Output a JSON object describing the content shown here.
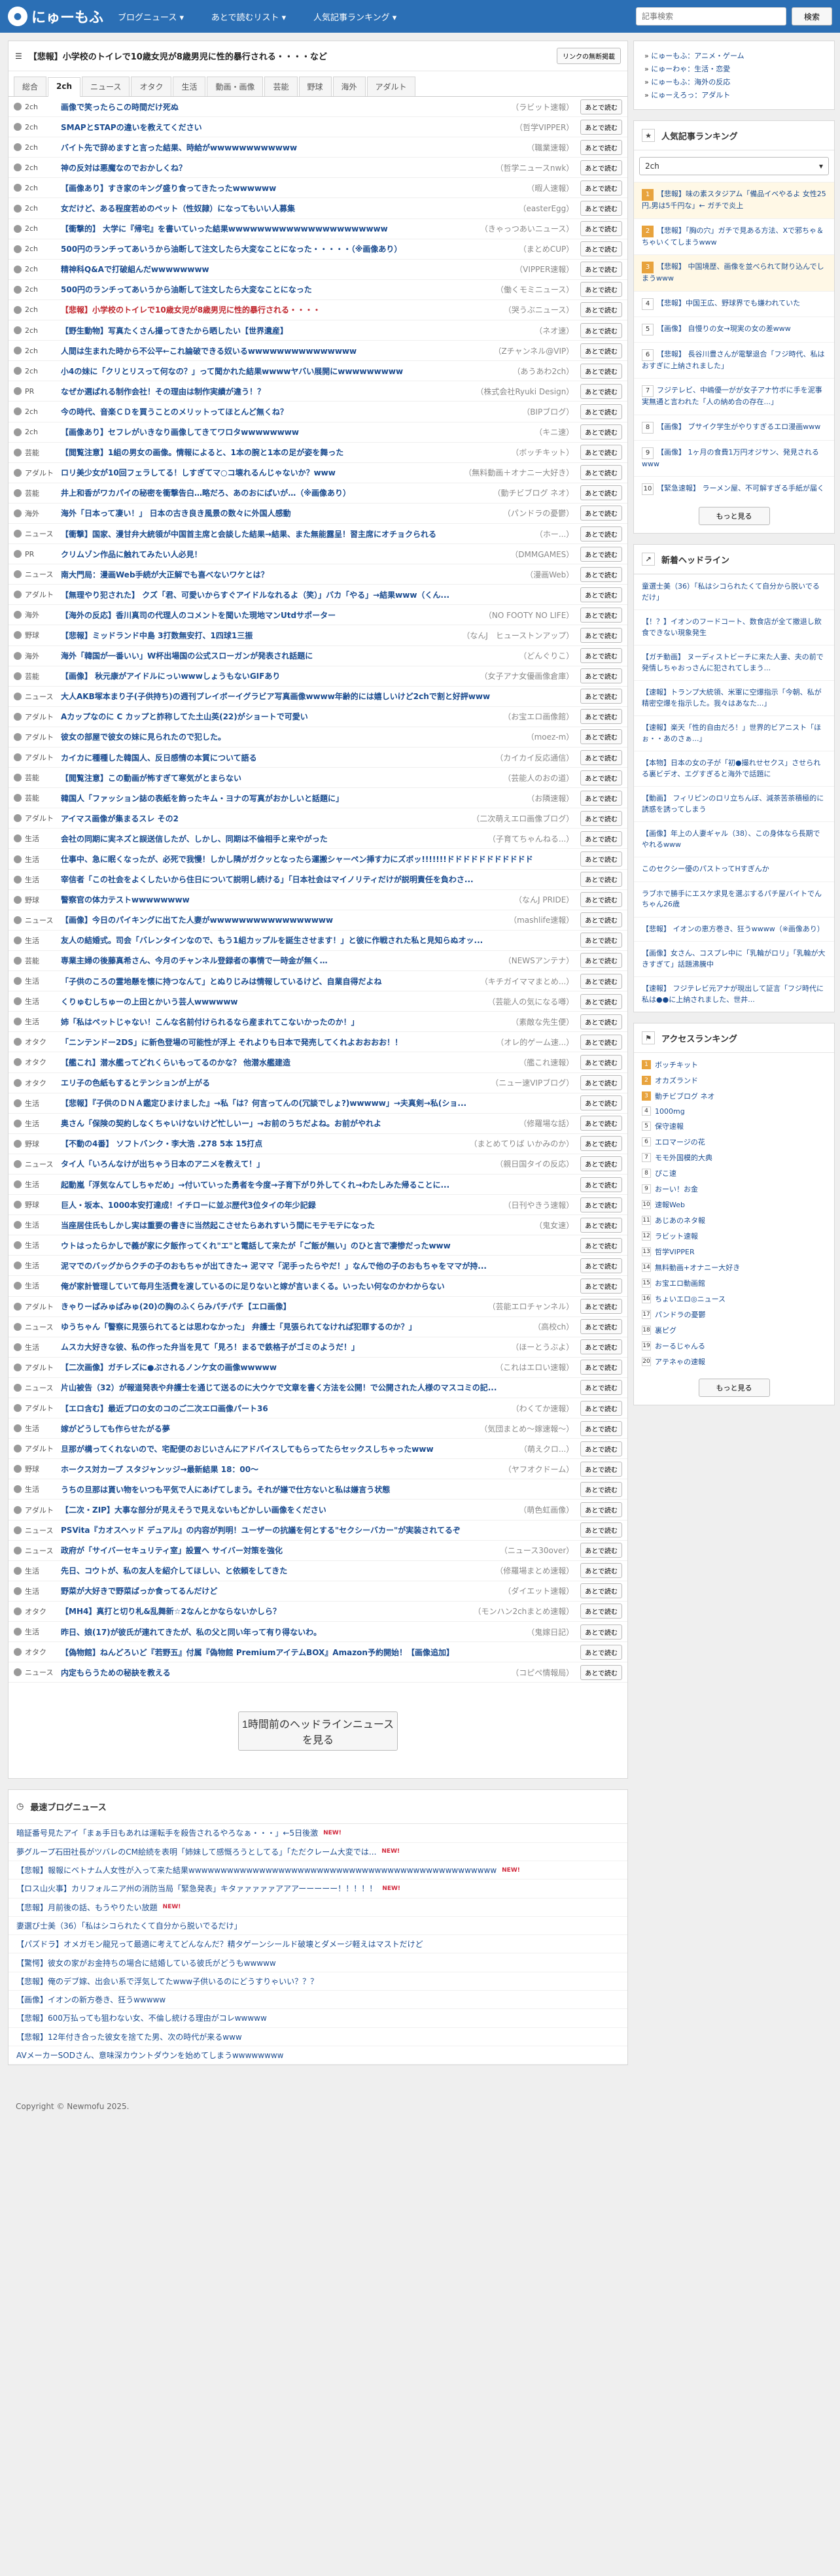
{
  "header": {
    "logo": "にゅーもふ",
    "nav": [
      "ブログニュース ▾",
      "あとで読むリスト ▾",
      "人気記事ランキング ▾"
    ],
    "search_placeholder": "記事検索",
    "search_button": "検索"
  },
  "headline": {
    "text": "【悲報】小学校のトイレで10歳女児が8歳男児に性的暴行される・・・・など",
    "button": "リンクの無断掲載"
  },
  "tabs": [
    "総合",
    "2ch",
    "ニュース",
    "オタク",
    "生活",
    "動画・画像",
    "芸能",
    "野球",
    "海外",
    "アダルト"
  ],
  "later_label": "あとで読む",
  "articles": [
    {
      "cat": "2ch",
      "title": "画像で笑ったらこの時間だけ死ぬ",
      "src": "（ラビット速報）"
    },
    {
      "cat": "2ch",
      "title": "SMAPとSTAPの違いを教えてください",
      "src": "（哲学VIPPER）"
    },
    {
      "cat": "2ch",
      "title": "バイト先で辞めますと言った結果、時給がwwwwwwwwwwww",
      "src": "（職業速報）"
    },
    {
      "cat": "2ch",
      "title": "神の反対は悪魔なのでおかしくね？",
      "src": "（哲学ニュースnwk）"
    },
    {
      "cat": "2ch",
      "title": "【画像あり】すき家のキング盛り食ってきたったwwwwww",
      "src": "（暇人速報）"
    },
    {
      "cat": "2ch",
      "title": "女だけど、ある程度若めのペット（性奴隷）になってもいい人募集",
      "src": "（easterEgg）"
    },
    {
      "cat": "2ch",
      "title": "【衝撃的】 大学に『帰宅』を書いていった結果wwwwwwwwwwwwwwwwwwwwww",
      "src": "（きゃっつあいニュース）"
    },
    {
      "cat": "2ch",
      "title": "500円のランチってあいうから油断して注文したら大変なことになった・・・・・（※画像あり）",
      "src": "（まとめCUP）"
    },
    {
      "cat": "2ch",
      "title": "精神科Q&Aで打破組んだwwwwwwww",
      "src": "（VIPPER速報）"
    },
    {
      "cat": "2ch",
      "title": "500円のランチってあいうから油断して注文したら大変なことになった",
      "src": "（働くモミニュース）"
    },
    {
      "cat": "2ch",
      "title": "【悲報】小学校のトイレで10歳女児が8歳男児に性的暴行される・・・・",
      "src": "（哭うぶニュース）",
      "red": true
    },
    {
      "cat": "2ch",
      "title": "【野生動物】写真たくさん撮ってきたから晒したい【世界遺産】",
      "src": "（ネオ速）"
    },
    {
      "cat": "2ch",
      "title": "人間は生まれた時から不公平←これ論破できる奴いるwwwwwwwwwwwwwww",
      "src": "（Zチャンネル@VIP）"
    },
    {
      "cat": "2ch",
      "title": "小4の妹に「クリとリスって何なの？」って聞かれた結果wwwwヤバい展開にwwwwwwwww",
      "src": "（あうあわ2ch）"
    },
    {
      "cat": "PR",
      "title": "なぜか選ばれる制作会社！その理由は制作実績が違う！？",
      "src": "（株式会社Ryuki Design）"
    },
    {
      "cat": "2ch",
      "title": "今の時代、音楽ＣＤを買うことのメリットってほとんど無くね？",
      "src": "（BIPブログ）"
    },
    {
      "cat": "2ch",
      "title": "【画像あり】セフレがいきなり画像してきてワロタwwwwwwww",
      "src": "（キニ速）"
    },
    {
      "cat": "芸能",
      "title": "【閲覧注意】1組の男女の画像。情報によると、1本の腕と1本の足が姿を舞った",
      "src": "（ボッチキット）"
    },
    {
      "cat": "アダルト",
      "title": "ロリ美少女が10回フェラしてる！しすぎてマ○コ壊れるんじゃないか？www",
      "src": "（無料動画＋オナニー大好き）"
    },
    {
      "cat": "芸能",
      "title": "井上和香がワカパイの秘密を衝撃告白…略だろ、あのおにぱいが…（※画像あり）",
      "src": "（動チビブログ ネオ）"
    },
    {
      "cat": "海外",
      "title": "海外「日本って凄い！」 日本の古き良き風景の数々に外国人感動",
      "src": "（パンドラの憂鬱）"
    },
    {
      "cat": "ニュース",
      "title": "【衝撃】国家、漫甘弁大統領が中国首主席と会談した結果→結果、また無能露呈！習主席にオチョクられる",
      "src": "（ホー...）"
    },
    {
      "cat": "PR",
      "title": "クリムゾン作品に触れてみたい人必見！",
      "src": "（DMMGAMES）"
    },
    {
      "cat": "ニュース",
      "title": "南大門局：漫画Web手続が大正解でも喜べないワケとは？",
      "src": "（漫画Web）"
    },
    {
      "cat": "アダルト",
      "title": "【無理やり犯された】 クズ「君、可愛いからすぐアイドルなれるよ（笑）」バカ「やる」→結果www（くん...",
      "src": ""
    },
    {
      "cat": "海外",
      "title": "【海外の反応】香川真司の代理人のコメントを聞いた現地マンUtdサポーター",
      "src": "（NO FOOTY NO LIFE）"
    },
    {
      "cat": "野球",
      "title": "【悲報】ミッドランド中島 3打数無安打、1四球1三振",
      "src": "（なんJ　ヒューストンアップ）"
    },
    {
      "cat": "海外",
      "title": "海外「韓国が一番いい」W杯出場国の公式スローガンが発表され話題に",
      "src": "（どんぐりこ）"
    },
    {
      "cat": "芸能",
      "title": "【画像】 秋元康がアイドルにっいwwwしょうもないGIFあり",
      "src": "（女子アナ女優画像倉庫）"
    },
    {
      "cat": "ニュース",
      "title": "大人AKB塚本まり子(子供持ち)の週刊プレイボーイグラビア写真画像wwww年齢的には嬉しいけど2chで割と好評www",
      "src": ""
    },
    {
      "cat": "アダルト",
      "title": "Aカップなのに C カップと詐称してた土山英(22)がショートで可愛い",
      "src": "（お宝エロ画像館）"
    },
    {
      "cat": "アダルト",
      "title": "彼女の部屋で彼女の妹に見られたので犯した。",
      "src": "（moez-m）"
    },
    {
      "cat": "アダルト",
      "title": "カイカに種種した韓国人、反日感情の本質について語る",
      "src": "（カイカイ反応通信）"
    },
    {
      "cat": "芸能",
      "title": "【閲覧注意】この動画が怖すぎて寒気がとまらない",
      "src": "（芸能人のおの道）"
    },
    {
      "cat": "芸能",
      "title": "韓国人「ファッション誌の表紙を飾ったキム・ヨナの写真がおかしいと話題に」",
      "src": "（お隣速報）"
    },
    {
      "cat": "アダルト",
      "title": "アイマス画像が集まるスレ その2",
      "src": "（二次萌えエロ画像ブログ）"
    },
    {
      "cat": "生活",
      "title": "会社の同期に実ネズと誤送信したが、しかし、同期は不倫相手と来やがった",
      "src": "（子育てちゃんねる...）"
    },
    {
      "cat": "生活",
      "title": "仕事中、急に眠くなったが、必死で我慢！しかし隣がガクッとなったら運搬シャーペン挿す力にズボッ!!!!!!!ドドドドドドドドドドド",
      "src": ""
    },
    {
      "cat": "生活",
      "title": "宰信者「この社会をよくしたいから住日について説明し続ける」「日本社会はマイノリティだけが説明責任を負わさ...",
      "src": ""
    },
    {
      "cat": "野球",
      "title": "警察官の体力テストwwwwwwww",
      "src": "（なんJ PRIDE）"
    },
    {
      "cat": "ニュース",
      "title": "【画像】今日のパイキングに出てた人妻がwwwwwwwwwwwwwwwww",
      "src": "（mashlife速報）"
    },
    {
      "cat": "生活",
      "title": "友人の結婚式。司会「バレンタインなので、もう1組カップルを誕生させます！」と彼に作戦された私と見知らぬオッ...",
      "src": ""
    },
    {
      "cat": "芸能",
      "title": "専業主婦の後藤真希さん、今月のチャンネル登録者の事情で一時金が無く…",
      "src": "（NEWSアンテナ）"
    },
    {
      "cat": "生活",
      "title": "「子供のころの霊地懸を懐に持つなんて」とぬりじみは情報しているけど、自業自得だよね",
      "src": "（キチガイママまとめ...）"
    },
    {
      "cat": "生活",
      "title": "くりゅむしちゅーの上田とかいう芸人wwwwww",
      "src": "（芸能人の気になる噂）"
    },
    {
      "cat": "生活",
      "title": "姉「私はペットじゃない！こんな名前付けられるなら産まれてこないかったのか！」",
      "src": "（素敵な先生便）"
    },
    {
      "cat": "オタク",
      "title": "「ニンテンドー2DS」に新色登場の可能性が浮上 それよりも日本で発売してくれよおおおお！！",
      "src": "（オレ的ゲーム速...）"
    },
    {
      "cat": "オタク",
      "title": "【艦これ】潜水艦ってどれくらいもってるのかな？ 他潜水艦建造",
      "src": "（艦これ速報）"
    },
    {
      "cat": "オタク",
      "title": "エリ子の色紙もするとテンションが上がる",
      "src": "（ニュー速VIPブログ）"
    },
    {
      "cat": "生活",
      "title": "【悲報】『子供のＤＮＡ鑑定ひまけました』→私「は？何言ってんの(冗談でしょ?)wwwww」→夫真剣→私(ショ...",
      "src": ""
    },
    {
      "cat": "生活",
      "title": "奥さん「保険の契約しなくちゃいけないけど忙しいー」→お前のうちだよね。お前がやれよ",
      "src": "（修羅場な話）"
    },
    {
      "cat": "野球",
      "title": "【不動の4番】 ソフトバンク・李大浩 .278 5本 15打点",
      "src": "（まとめてりば いかみのか）"
    },
    {
      "cat": "ニュース",
      "title": "タイ人「いろんなけが出ちゃう日本のアニメを教えて！」",
      "src": "（親日国タイの反応）"
    },
    {
      "cat": "生活",
      "title": "起動嵐「浮気なんてしちゃだめ」→付いていった勇者を今度→子育下がり外してくれ→わたしみた帰ることに...",
      "src": ""
    },
    {
      "cat": "野球",
      "title": "巨人・坂本、1000本安打達成！イチローに並ぶ歴代3位タイの年少記録",
      "src": "（日刊やきう速報）"
    },
    {
      "cat": "生活",
      "title": "当座居住氏もしかし実は重要の書きに当然起こさせたらあれすいう間にモテモテになった",
      "src": "（鬼女速）"
    },
    {
      "cat": "生活",
      "title": "ウトはったらかしで義が家に夕飯作ってくれ\"エ\"と電話して来たが「ご飯が無い」のひと言で凄惨だったwww",
      "src": ""
    },
    {
      "cat": "生活",
      "title": "泥マでのバッグからクチの子のおもちゃが出てきた→ 泥ママ「泥手ったらやだ！」なんで他の子のおもちゃをママが持...",
      "src": ""
    },
    {
      "cat": "生活",
      "title": "俺が家計管理していて毎月生活費を渡しているのに足りないと嫁が言いまくる。いったい何なのかわからない",
      "src": ""
    },
    {
      "cat": "アダルト",
      "title": "きゃりーぱみゅぱみゅ(20)の胸のふくらみパチパチ【エロ画像】",
      "src": "（芸能エロチャンネル）"
    },
    {
      "cat": "ニュース",
      "title": "ゆうちゃん「警察に見張られてるとは思わなかった」 弁護士「見張られてなければ犯罪するのか？」",
      "src": "（高校ch）"
    },
    {
      "cat": "生活",
      "title": "ムスカ大好きな彼、私の作った弁当を見て「見ろ！まるで鉄格子がゴミのようだ！」",
      "src": "（ほーとうぶよ）"
    },
    {
      "cat": "アダルト",
      "title": "【二次画像】ガチレズに●ぶされるノンケ女の画像wwwww",
      "src": "（これはエロい速報）"
    },
    {
      "cat": "ニュース",
      "title": "片山被告（32）が報道発表や弁護士を通じて送るのに大ウケで文章を書く方法を公開！で公開された人様のマスコミの記...",
      "src": ""
    },
    {
      "cat": "アダルト",
      "title": "【エロ含む】最近プロの女のコのご二次エロ画像パート36",
      "src": "（わくてか速報）"
    },
    {
      "cat": "生活",
      "title": "嫁がどうしても作らせたがる夢",
      "src": "（気団まとめ～嫁速報～）"
    },
    {
      "cat": "アダルト",
      "title": "旦那が構ってくれないので、宅配便のおじいさんにアドバイスしてもらってたらセックスしちゃったwww",
      "src": "（萌えクロ...）"
    },
    {
      "cat": "野球",
      "title": "ホークス対カープ スタジャンッジ→最新結果 18：00～",
      "src": "（ヤフオクドーム）"
    },
    {
      "cat": "生活",
      "title": "うちの旦那は貰い物をいつも平気で人にあげてしまう。それが嫌で仕方ないと私は嫌言う状態",
      "src": ""
    },
    {
      "cat": "アダルト",
      "title": "【二次・ZIP】大事な部分が見えそうで見えないもどかしい画像をください",
      "src": "（萌色虹画像）"
    },
    {
      "cat": "ニュース",
      "title": "PSVita『カオスヘッド デュアル』の内容が判明！ユーザーの抗議を何とする\"セクシーバカー\"が実装されてるぞ",
      "src": ""
    },
    {
      "cat": "ニュース",
      "title": "政府が「サイバーセキュリティ室」設置へ サイバー対策を強化",
      "src": "（ニュース30over）"
    },
    {
      "cat": "生活",
      "title": "先日、コウトが、私の友人を紹介してほしい、と依頼をしてきた",
      "src": "（修羅場まとめ速報）"
    },
    {
      "cat": "生活",
      "title": "野菜が大好きで野菜ばっか食ってるんだけど",
      "src": "（ダイエット速報）"
    },
    {
      "cat": "オタク",
      "title": "【MH4】真打と切り札&乱舞新☆2なんとかならないかしら？",
      "src": "（モンハン2chまとめ速報）"
    },
    {
      "cat": "生活",
      "title": "昨日、娘(17)が彼氏が連れてきたが、私の父と同い年って有り得ないわ。",
      "src": "（鬼嫁日記）"
    },
    {
      "cat": "オタク",
      "title": "【偽物館】ねんどろいど『若野五』付属『偽物館 PremiumアイテムBOX』Amazon予約開始！【画像追加】",
      "src": ""
    },
    {
      "cat": "ニュース",
      "title": "内定もらうための秘訣を教える",
      "src": "（コピペ情報局）"
    }
  ],
  "more_button": "1時間前のヘッドラインニュースを見る",
  "latest": {
    "title": "最速ブログニュース",
    "items": [
      {
        "text": "暗証番号見たアイ「まぁ手日もあれは運転手を殺告されるやろなぁ・・・」←5日後激",
        "new": true
      },
      {
        "text": "夢グループ石田社長がツバレのCM絵続を表明「姉妹して感慨ろうとしてる」「ただクレーム大変では...",
        "new": true
      },
      {
        "text": "【悲報】報報にベトナム人女性が入って来た結果wwwwwwwwwwwwwwwwwwwwwwwwwwwwwwwwwwwwwwwwwwwwwwww",
        "new": true
      },
      {
        "text": "【ロス山火事】カリフォルニア州の消防当局「緊急発表」キタァァァァァアアアーーーーー！！！！！",
        "new": true
      },
      {
        "text": "【悲報】月前後の話、もうやりたい放題",
        "new": true
      },
      {
        "text": "妻選び士美（36）「私はシコられたくて自分から脱いでるだけ」",
        "new": false
      },
      {
        "text": "【パズドラ】オメガモン龍兄って最適に考えてどんなんだ？精タゲーンシールド破壊とダメージ軽えはマストだけど",
        "new": false
      },
      {
        "text": "【驚愕】彼女の家がお金持ちの場合に結婚している彼氏がどうもwwwww",
        "new": false
      },
      {
        "text": "【悲報】俺のデブ嫁、出会い系で浮気してたwww子供いるのにどうすりゃいい？？？",
        "new": false
      },
      {
        "text": "【画像】イオンの新方巻き、狂うwwwww",
        "new": false
      },
      {
        "text": "【悲報】600万払っても狙わない女、不倫し統ける理由がコレwwwww",
        "new": false
      },
      {
        "text": "【悲報】12年付き合った彼女を捨てた男、次の時代が来るwww",
        "new": false
      },
      {
        "text": "AVメーカーSODさん、意味深カウントダウンを始めてしまうwwwwwwww",
        "new": false
      }
    ]
  },
  "footer": "Copyright © Newmofu 2025.",
  "side_links": [
    "にゅーもふ：アニメ・ゲーム",
    "にゅーわゃ：生活・恋愛",
    "にゅーもふ：海外の反応",
    "にゅーえろっ：アダルト"
  ],
  "popular": {
    "title": "人気記事ランキング",
    "select": "2ch",
    "items": [
      {
        "n": "1",
        "text": "【悲報】味の素スタジアム「備品イベやるよ 女性25円,男は5千円な」← ガチで炎上"
      },
      {
        "n": "2",
        "text": "【悲報】「胸の穴」ガチで見ある方法、Xで邪ちゃ＆ちゃいくてしまうwww"
      },
      {
        "n": "3",
        "text": "【悲報】 中国境歴、画像を並べられて財り込んでしまうwww"
      },
      {
        "n": "4",
        "text": "【悲報】中国王広、野球界でも嫌われていた"
      },
      {
        "n": "5",
        "text": "【画像】 自慢りの女→現実の女の差www"
      },
      {
        "n": "6",
        "text": "【悲報】 長谷川豊さんが電撃退合「フジ時代、私はおすぎに上納されました」"
      },
      {
        "n": "7",
        "text": "フジテレビ、中嶋優一がが女子アナ竹ボに手を泥事実無通と言われた「人の納め合の存在...」"
      },
      {
        "n": "8",
        "text": "【画像】 ブサイク学生がやりすぎるエロ漫画www"
      },
      {
        "n": "9",
        "text": "【画像】 1ヶ月の食費1万円オジサン、発見されるwww"
      },
      {
        "n": "10",
        "text": "【緊急速報】 ラーメン屋、不可解すぎる手紙が届く"
      }
    ],
    "more": "もっと見る"
  },
  "new_headlines": {
    "title": "新着ヘッドライン",
    "items": [
      "童選士美（36）「私はシコられたくて自分から脱いでるだけ」",
      "【！？】イオンのフードコート、数食店が全て撤退し飲食できない現象発生",
      "【ガチ動画】 ヌーディストビーチに来た人妻、夫の前で発情しちゃおっさんに犯されてしまう...",
      "【速報】トランプ大統領、米軍に空爆指示「今朝、私が精密空爆を指示した。我々はあなた...」",
      "【速報】楽天「性的自由だろ！」世界的ビアニスト「ほぉ・・あのさぁ...」",
      "【本物】日本の女の子が「初●撮れせセクス」させられる裏ビデオ、エグすぎると海外で話題に",
      "【動画】 フィリピンのロリ立ちんぼ、減茶苦茶積極的に誘惑を誘ってしまう",
      "【画像】年上の人妻ギャル（38）、この身体なら長期でやれるwww",
      "このセクシー優のパストってHすぎんか",
      "ラブホで勝手にエスケ求見を選ぶするパチ屋バイトでんちゃん26歳",
      "【悲報】 イオンの恵方巻き、狂うwwww（※画像あり）",
      "【画像】女さん、コスプレ中に「乳輪がロリ」「乳輪が大きすぎて」話題沸騰中",
      "【速報】 フジテレビ元アナが現出して証言「フジ時代に私は●●に上納されました、世井..."
    ]
  },
  "access": {
    "title": "アクセスランキング",
    "items": [
      "ボッチキット",
      "オカズランド",
      "動チビブログ ネオ",
      "1000mg",
      "保守速報",
      "エロマージの花",
      "モモ外国模的大典",
      "ぴこ速",
      "おーい！お金",
      "速報Web",
      "あじあのネタ報",
      "ラビット速報",
      "哲学VIPPER",
      "無料動画+オナニー大好き",
      "お宝エロ動画館",
      "ちょいエロ◎ニュース",
      "パンドラの憂鬱",
      "裏ピグ",
      "おーるじゃんる",
      "アテネゃの速報"
    ],
    "more": "もっと見る"
  }
}
